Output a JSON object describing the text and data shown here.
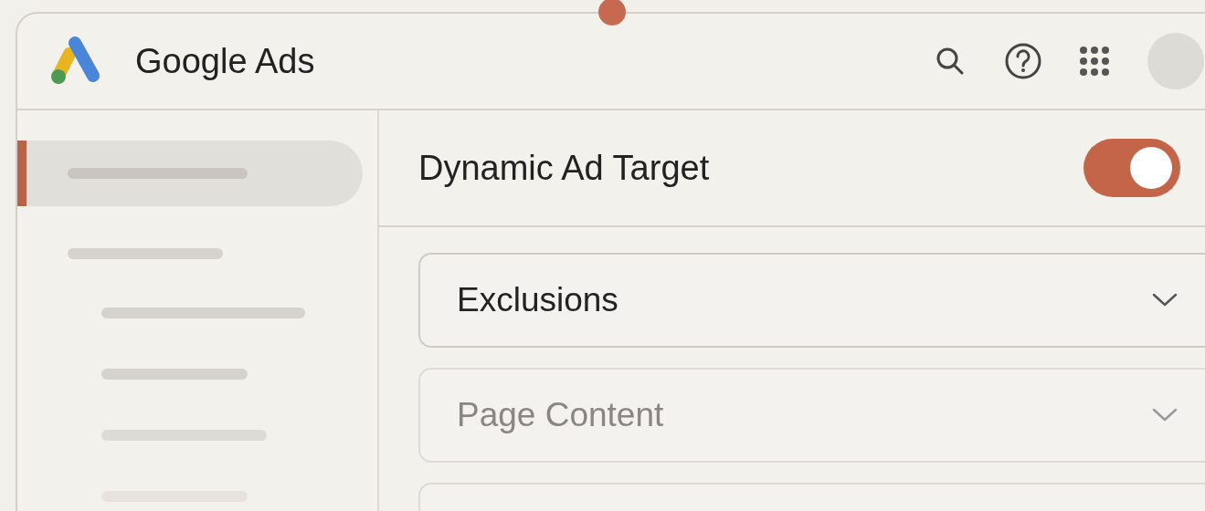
{
  "app": {
    "title": "Google Ads"
  },
  "sidebar": {
    "items": [
      {
        "selected": true
      },
      {
        "selected": false,
        "children": [
          {
            "selected": false
          },
          {
            "selected": false
          },
          {
            "selected": false
          },
          {
            "selected": false
          }
        ]
      }
    ]
  },
  "panel": {
    "title": "Dynamic Ad Target",
    "toggle": {
      "on": true
    }
  },
  "sections": [
    {
      "label": "Exclusions",
      "disabled": false
    },
    {
      "label": "Page Content",
      "disabled": true
    },
    {
      "disabled": true
    }
  ]
}
